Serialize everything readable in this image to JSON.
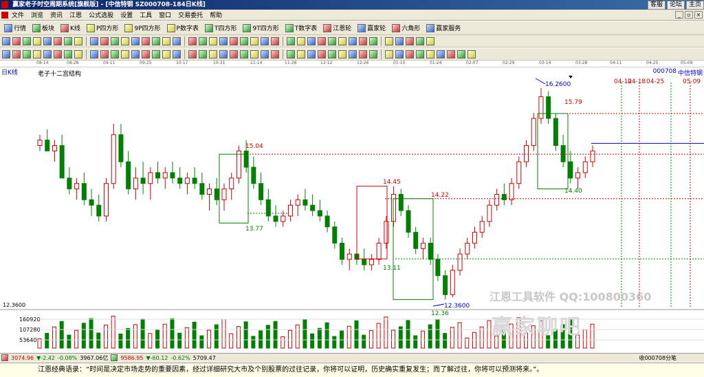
{
  "window": {
    "title": "赢家老子时空周期系统[旗舰版] - [中信特钢   SZ000708-184日K线]",
    "top_links": [
      "客服",
      "论坛",
      "主页"
    ]
  },
  "menu": [
    "文件",
    "浏览",
    "资讯",
    "江恩",
    "公式选股",
    "设置",
    "工具",
    "窗口",
    "交易委托",
    "帮助"
  ],
  "toolbar1": [
    "行情",
    "板块",
    "K线",
    "P四方形",
    "9P四方形",
    "P数字表",
    "T四方形",
    "9T四方形",
    "T数字表",
    "江恩轮",
    "赢家轮",
    "六角形",
    "赢家服务"
  ],
  "time_axis": [
    "08-14",
    "08-28",
    "09-11",
    "09-25",
    "10-17",
    "10-31",
    "11-14",
    "11-28",
    "12-12",
    "12-26",
    "01-10",
    "01-24",
    "02-07",
    "02-29",
    "03-14",
    "03-28",
    "04-11",
    "04-25",
    "05-09"
  ],
  "chart_header": {
    "period": "日K线",
    "study": "老子十二宫结构",
    "code": "000708",
    "name": "中信特钢"
  },
  "chart_data": {
    "type": "candlestick",
    "annotations": [
      "16.2600",
      "15.79",
      "15.04",
      "14.45",
      "14.22",
      "14.40",
      "13.77",
      "13.11",
      "12.36",
      "12.3600"
    ],
    "future_dates": [
      "04-12",
      "04-18",
      "04-25",
      "05-09"
    ],
    "price_scale_label": "12.3600",
    "volume_labels": [
      "160920",
      "107280",
      "53640"
    ],
    "ohlc": [
      [
        15.2,
        15.4,
        15.1,
        15.3
      ],
      [
        15.3,
        15.5,
        15.2,
        15.1
      ],
      [
        15.1,
        15.3,
        14.9,
        15.2
      ],
      [
        15.2,
        15.4,
        15.0,
        14.6
      ],
      [
        14.6,
        14.8,
        14.3,
        14.4
      ],
      [
        14.4,
        14.6,
        14.2,
        14.5
      ],
      [
        14.5,
        14.7,
        14.1,
        14.2
      ],
      [
        14.2,
        14.4,
        13.9,
        14.1
      ],
      [
        14.1,
        14.3,
        13.8,
        13.9
      ],
      [
        13.9,
        14.6,
        13.8,
        14.5
      ],
      [
        14.5,
        15.6,
        14.4,
        15.4
      ],
      [
        15.4,
        15.6,
        14.8,
        14.9
      ],
      [
        14.9,
        15.1,
        14.3,
        14.4
      ],
      [
        14.4,
        14.8,
        14.2,
        14.6
      ],
      [
        14.6,
        14.9,
        14.3,
        14.5
      ],
      [
        14.5,
        14.8,
        14.2,
        14.7
      ],
      [
        14.7,
        14.9,
        14.5,
        14.6
      ],
      [
        14.6,
        14.8,
        14.4,
        14.7
      ],
      [
        14.7,
        14.9,
        14.5,
        14.6
      ],
      [
        14.6,
        14.8,
        14.4,
        14.5
      ],
      [
        14.5,
        14.7,
        14.3,
        14.6
      ],
      [
        14.6,
        14.8,
        14.4,
        14.5
      ],
      [
        14.5,
        14.7,
        14.2,
        14.3
      ],
      [
        14.3,
        14.5,
        14.0,
        14.4
      ],
      [
        14.4,
        14.6,
        14.1,
        14.2
      ],
      [
        14.2,
        14.5,
        14.0,
        14.4
      ],
      [
        14.4,
        14.7,
        14.2,
        14.6
      ],
      [
        14.6,
        15.2,
        14.5,
        15.1
      ],
      [
        15.1,
        15.3,
        14.7,
        14.8
      ],
      [
        14.8,
        15.0,
        14.4,
        14.5
      ],
      [
        14.5,
        14.7,
        14.1,
        14.2
      ],
      [
        14.2,
        14.4,
        13.8,
        13.9
      ],
      [
        13.9,
        14.1,
        13.7,
        13.8
      ],
      [
        13.8,
        14.0,
        13.7,
        13.9
      ],
      [
        13.9,
        14.2,
        13.8,
        14.1
      ],
      [
        14.1,
        14.3,
        13.9,
        14.2
      ],
      [
        14.2,
        14.4,
        14.0,
        14.1
      ],
      [
        14.1,
        14.3,
        13.9,
        14.0
      ],
      [
        14.0,
        14.2,
        13.8,
        13.9
      ],
      [
        13.9,
        14.0,
        13.6,
        13.7
      ],
      [
        13.7,
        13.8,
        13.3,
        13.4
      ],
      [
        13.4,
        13.5,
        13.0,
        13.1
      ],
      [
        13.1,
        13.3,
        12.9,
        13.2
      ],
      [
        13.2,
        13.4,
        13.0,
        13.1
      ],
      [
        13.1,
        13.3,
        12.9,
        13.0
      ],
      [
        13.0,
        13.2,
        12.9,
        13.1
      ],
      [
        13.1,
        13.5,
        13.0,
        13.4
      ],
      [
        13.4,
        13.9,
        13.3,
        13.8
      ],
      [
        13.8,
        14.45,
        13.7,
        14.3
      ],
      [
        14.3,
        14.4,
        13.9,
        14.0
      ],
      [
        14.0,
        14.1,
        13.5,
        13.6
      ],
      [
        13.6,
        13.7,
        13.2,
        13.3
      ],
      [
        13.3,
        13.5,
        13.1,
        13.4
      ],
      [
        13.4,
        13.5,
        13.0,
        13.1
      ],
      [
        13.1,
        13.2,
        12.7,
        12.8
      ],
      [
        12.8,
        12.9,
        12.36,
        12.45
      ],
      [
        12.45,
        13.0,
        12.4,
        12.9
      ],
      [
        12.9,
        13.3,
        12.8,
        13.2
      ],
      [
        13.2,
        13.5,
        13.1,
        13.4
      ],
      [
        13.4,
        13.7,
        13.3,
        13.6
      ],
      [
        13.6,
        13.9,
        13.5,
        13.8
      ],
      [
        13.8,
        14.2,
        13.7,
        14.1
      ],
      [
        14.1,
        14.4,
        14.0,
        14.3
      ],
      [
        14.3,
        14.5,
        14.1,
        14.2
      ],
      [
        14.2,
        14.6,
        14.1,
        14.5
      ],
      [
        14.5,
        15.0,
        14.4,
        14.9
      ],
      [
        14.9,
        15.3,
        14.8,
        15.2
      ],
      [
        15.2,
        15.8,
        15.1,
        15.7
      ],
      [
        15.7,
        16.26,
        15.6,
        16.1
      ],
      [
        16.1,
        16.2,
        15.6,
        15.7
      ],
      [
        15.7,
        15.8,
        15.1,
        15.2
      ],
      [
        15.2,
        15.4,
        14.8,
        14.9
      ],
      [
        14.9,
        15.1,
        14.5,
        14.6
      ],
      [
        14.6,
        14.8,
        14.4,
        14.7
      ],
      [
        14.7,
        15.0,
        14.6,
        14.9
      ],
      [
        14.9,
        15.2,
        14.8,
        15.1
      ]
    ]
  },
  "status": {
    "sh_value": "3074.96",
    "sh_change": "-2.42",
    "sh_pct": "-0.08%",
    "sh_amount": "3967.06亿",
    "sz_value": "9586.95",
    "sz_change": "-60.12",
    "sz_pct": "-0.62%",
    "sz_amount": "5709.47",
    "right_text": "收000708分笔"
  },
  "watermark": {
    "line1": "江恩工具软件  QQ:100800360",
    "line2": "赢家聊吧"
  },
  "quote": "江恩经典语录：“时间是决定市场走势的重要因素，经过详细研究大市及个别股票的过往记录，你将可以证明，历史确实重复发生；而了解过往，你将可以预测将来。”。"
}
